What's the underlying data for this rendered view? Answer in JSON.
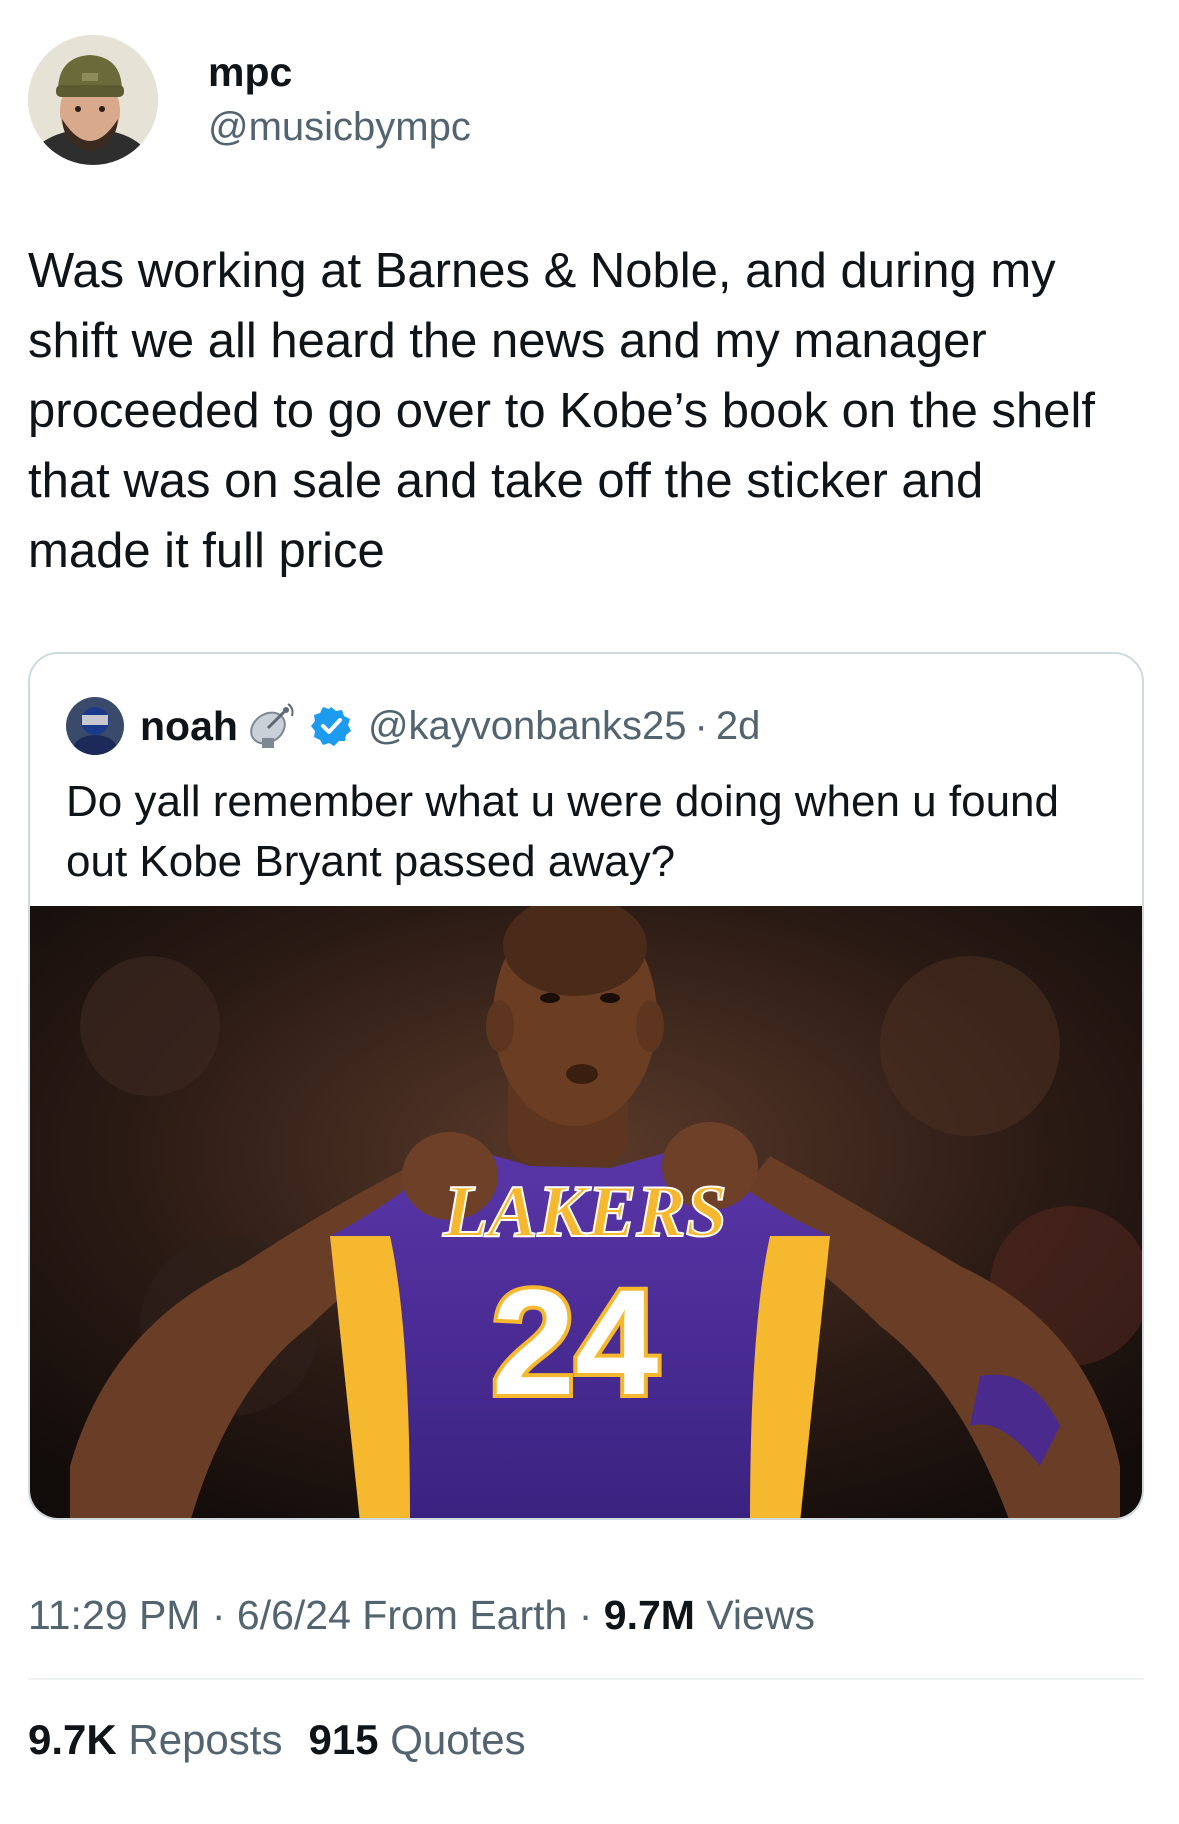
{
  "author": {
    "display_name": "mpc",
    "handle": "@musicbympc",
    "avatar_icon": "person-avatar-beanie-beard"
  },
  "tweet": {
    "text": "Was working at Barnes & Noble, and during my\nshift we all heard the news and my manager\nproceeded to go over to Kobe’s book on the shelf\nthat was on sale and take off the sticker and\nmade it full price"
  },
  "quoted_tweet": {
    "display_name": "noah",
    "emoji_icon": "satellite-antenna-icon",
    "verified_icon": "verified-badge-icon",
    "handle": "@kayvonbanks25",
    "separator": "·",
    "time_ago": "2d",
    "text": "Do yall remember what u were doing when u found out Kobe Bryant passed away?",
    "image": {
      "description_icon": "basketball-player-photo",
      "jersey_team": "LAKERS",
      "jersey_number": "24"
    }
  },
  "meta": {
    "time": "11:29 PM",
    "sep1": " · ",
    "date": "6/6/24",
    "source": " From Earth",
    "sep2": " · ",
    "views_count": "9.7M",
    "views_label": " Views"
  },
  "stats": {
    "reposts_count": "9.7K",
    "reposts_label": " Reposts",
    "quotes_count": "915",
    "quotes_label": " Quotes"
  },
  "colors": {
    "text_primary": "#0f1419",
    "text_secondary": "#536471",
    "border": "#cfd9de",
    "verified_blue": "#1d9bf0",
    "lakers_purple": "#4a2a8c",
    "lakers_gold": "#f5b82e"
  }
}
